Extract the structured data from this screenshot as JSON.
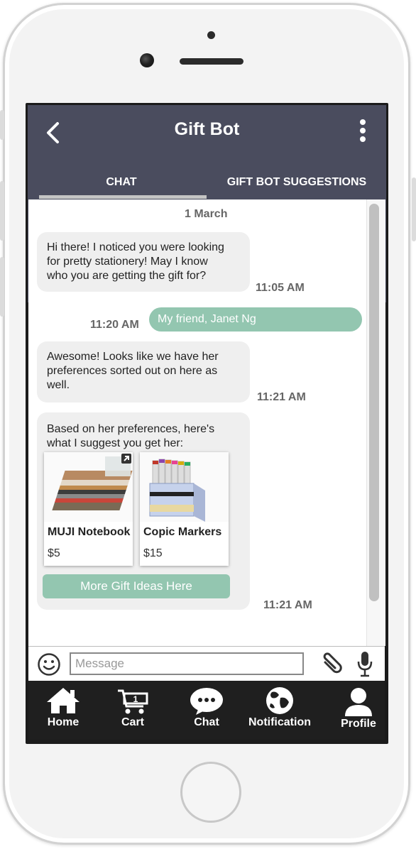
{
  "header": {
    "title": "Gift Bot"
  },
  "tabs": [
    {
      "label": "CHAT"
    },
    {
      "label": "GIFT BOT SUGGESTIONS"
    }
  ],
  "chat": {
    "date": "1 March",
    "messages": [
      {
        "from": "bot",
        "text_lines": [
          "Hi there! I noticed you were looking",
          "for pretty stationery! May I know",
          "who you are getting the gift for?"
        ],
        "time": "11:05 AM"
      },
      {
        "from": "user",
        "text": "My friend, Janet Ng",
        "time": "11:20 AM"
      },
      {
        "from": "bot",
        "text_lines": [
          "Awesome! Looks like we have her",
          "preferences sorted out on here as",
          "well."
        ],
        "time": "11:21 AM"
      },
      {
        "from": "bot",
        "text_lines": [
          "Based on her preferences, here's",
          "what I suggest you get her:"
        ],
        "time": "11:21 AM",
        "products": [
          {
            "name": "MUJI Notebook",
            "price": "$5"
          },
          {
            "name": "Copic Markers",
            "price": "$15"
          }
        ],
        "button": "More Gift Ideas Here"
      }
    ]
  },
  "composer": {
    "placeholder": "Message"
  },
  "nav": {
    "home": "Home",
    "cart": "Cart",
    "cart_count": "1",
    "chat": "Chat",
    "notification": "Notification",
    "profile": "Profile"
  },
  "colors": {
    "header": "#4a4c5e",
    "accent": "#93c6b0",
    "tabbar": "#1f1f1f"
  }
}
